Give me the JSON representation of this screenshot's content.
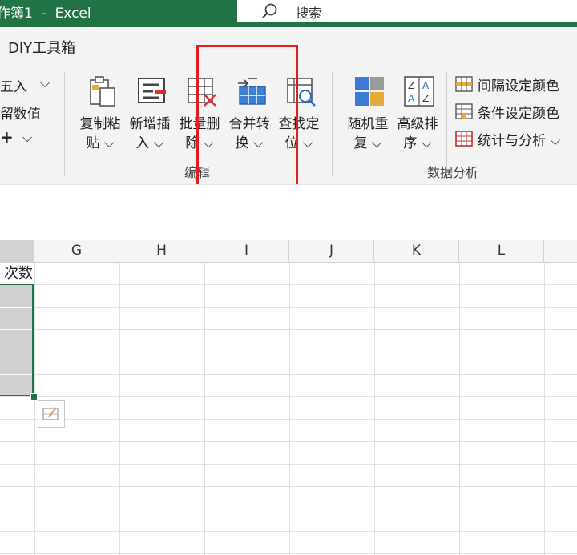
{
  "titlebar": {
    "title": "作簿1  -  Excel",
    "search_label": "搜索"
  },
  "ribbon": {
    "tab_label": "DIY工具箱",
    "left_partial": {
      "round": "五入",
      "keep_values": "留数值",
      "plus": "+"
    },
    "edit_group": {
      "label": "编辑",
      "buttons": [
        {
          "line1": "复制粘",
          "line2": "贴"
        },
        {
          "line1": "新增插",
          "line2": "入"
        },
        {
          "line1": "批量删",
          "line2": "除"
        },
        {
          "line1": "合并转",
          "line2": "换"
        },
        {
          "line1": "查找定",
          "line2": "位"
        }
      ]
    },
    "analysis_group": {
      "label": "数据分析",
      "buttons": [
        {
          "line1": "随机重",
          "line2": "复"
        },
        {
          "line1": "高级排",
          "line2": "序"
        }
      ],
      "small_buttons": [
        {
          "label": "间隔设定颜色"
        },
        {
          "label": "条件设定颜色"
        },
        {
          "label": "统计与分析"
        }
      ]
    },
    "dropdown_glyph": "⌵"
  },
  "sheet": {
    "columns": [
      "G",
      "H",
      "I",
      "J",
      "K",
      "L"
    ],
    "partial_header_cell": "次数"
  },
  "colors": {
    "excel_green": "#217346",
    "highlight_red": "#e02020"
  }
}
